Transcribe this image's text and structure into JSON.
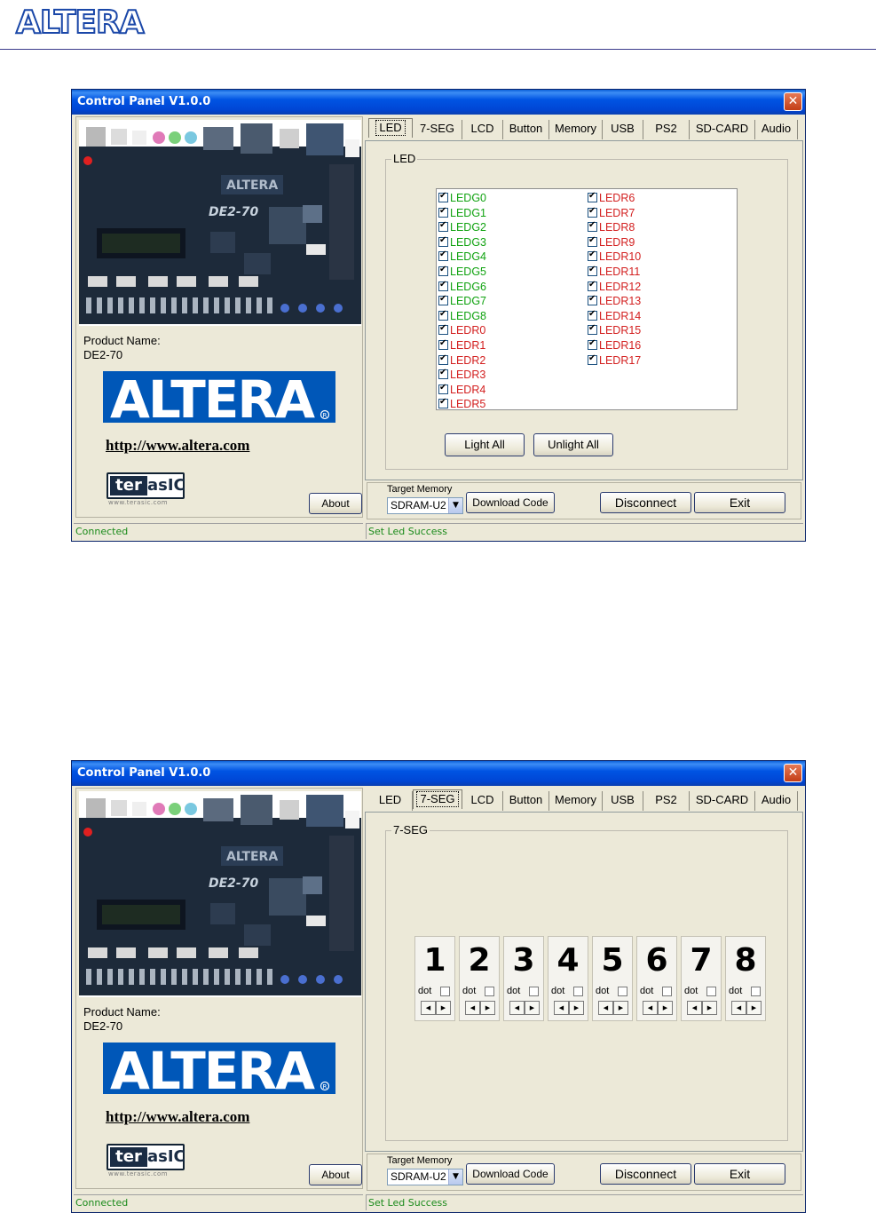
{
  "window1": {
    "title": "Control Panel V1.0.0",
    "close": "✕",
    "product_label": "Product Name:",
    "product_value": "DE2-70",
    "url": "http://www.altera.com",
    "about": "About",
    "tabs": [
      "LED",
      "7-SEG",
      "LCD",
      "Button",
      "Memory",
      "USB",
      "PS2",
      "SD-CARD",
      "Audio"
    ],
    "active_tab": "LED",
    "group_title": "LED",
    "leds_left": [
      "LEDG0",
      "LEDG1",
      "LEDG2",
      "LEDG3",
      "LEDG4",
      "LEDG5",
      "LEDG6",
      "LEDG7",
      "LEDG8",
      "LEDR0",
      "LEDR1",
      "LEDR2",
      "LEDR3",
      "LEDR4",
      "LEDR5"
    ],
    "leds_right": [
      "LEDR6",
      "LEDR7",
      "LEDR8",
      "LEDR9",
      "LEDR10",
      "LEDR11",
      "LEDR12",
      "LEDR13",
      "LEDR14",
      "LEDR15",
      "LEDR16",
      "LEDR17"
    ],
    "light_all": "Light All",
    "unlight_all": "Unlight All",
    "target_memory_label": "Target Memory",
    "target_memory_value": "SDRAM-U2",
    "download_code": "Download Code",
    "disconnect": "Disconnect",
    "exit": "Exit",
    "status_left": "Connected",
    "status_right": "Set Led Success"
  },
  "window2": {
    "title": "Control Panel V1.0.0",
    "close": "✕",
    "product_label": "Product Name:",
    "product_value": "DE2-70",
    "url": "http://www.altera.com",
    "about": "About",
    "tabs": [
      "LED",
      "7-SEG",
      "LCD",
      "Button",
      "Memory",
      "USB",
      "PS2",
      "SD-CARD",
      "Audio"
    ],
    "active_tab": "7-SEG",
    "group_title": "7-SEG",
    "digits": [
      "1",
      "2",
      "3",
      "4",
      "5",
      "6",
      "7",
      "8"
    ],
    "dot_label": "dot",
    "target_memory_label": "Target Memory",
    "target_memory_value": "SDRAM-U2",
    "download_code": "Download Code",
    "disconnect": "Disconnect",
    "exit": "Exit",
    "status_left": "Connected",
    "status_right": "Set Led Success"
  },
  "logos": {
    "altera_text": "ALTERA",
    "terasic_ter": "ter",
    "terasic_asic": "asIC",
    "terasic_url": "www.terasic.com",
    "board_label": "DE2-70"
  },
  "colors": {
    "led_green": "#11a311",
    "led_red": "#d32020",
    "titlebar": "#0054e3",
    "altera_blue": "#0057b8"
  }
}
